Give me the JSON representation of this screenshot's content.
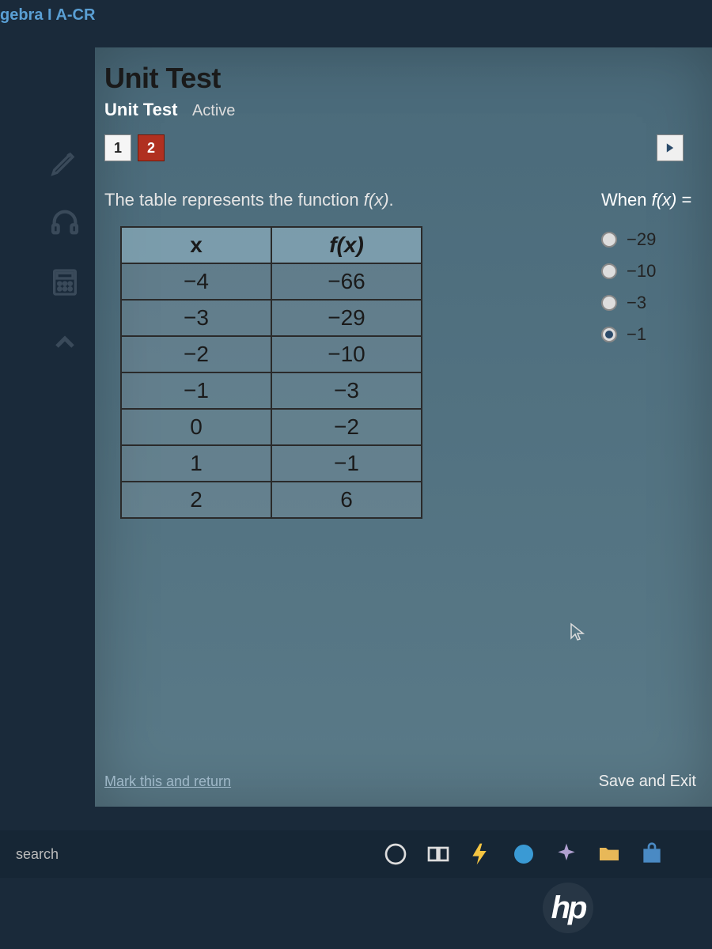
{
  "top_label": "gebra I A-CR",
  "header": {
    "title": "Unit Test",
    "subtitle": "Unit Test",
    "status": "Active"
  },
  "questions": [
    "1",
    "2"
  ],
  "active_question_index": 1,
  "prompt_prefix": "The table represents the function ",
  "prompt_fn": "f(x)",
  "prompt_suffix": ".",
  "table": {
    "headers": [
      "x",
      "f(x)"
    ],
    "rows": [
      [
        "−4",
        "−66"
      ],
      [
        "−3",
        "−29"
      ],
      [
        "−2",
        "−10"
      ],
      [
        "−1",
        "−3"
      ],
      [
        "0",
        "−2"
      ],
      [
        "1",
        "−1"
      ],
      [
        "2",
        "6"
      ]
    ]
  },
  "sub_prompt_prefix": "When ",
  "sub_prompt_fn": "f(x)",
  "sub_prompt_suffix": " =",
  "options": [
    {
      "label": "−29",
      "selected": false
    },
    {
      "label": "−10",
      "selected": false
    },
    {
      "label": "−3",
      "selected": false
    },
    {
      "label": "−1",
      "selected": true
    }
  ],
  "mark_return": "Mark this and return",
  "save_exit": "Save and Exit",
  "taskbar": {
    "search": "search"
  },
  "hp": "hp",
  "chart_data": {
    "type": "table",
    "title": "The table represents the function f(x).",
    "columns": [
      "x",
      "f(x)"
    ],
    "rows": [
      [
        -4,
        -66
      ],
      [
        -3,
        -29
      ],
      [
        -2,
        -10
      ],
      [
        -1,
        -3
      ],
      [
        0,
        -2
      ],
      [
        1,
        -1
      ],
      [
        2,
        6
      ]
    ]
  }
}
